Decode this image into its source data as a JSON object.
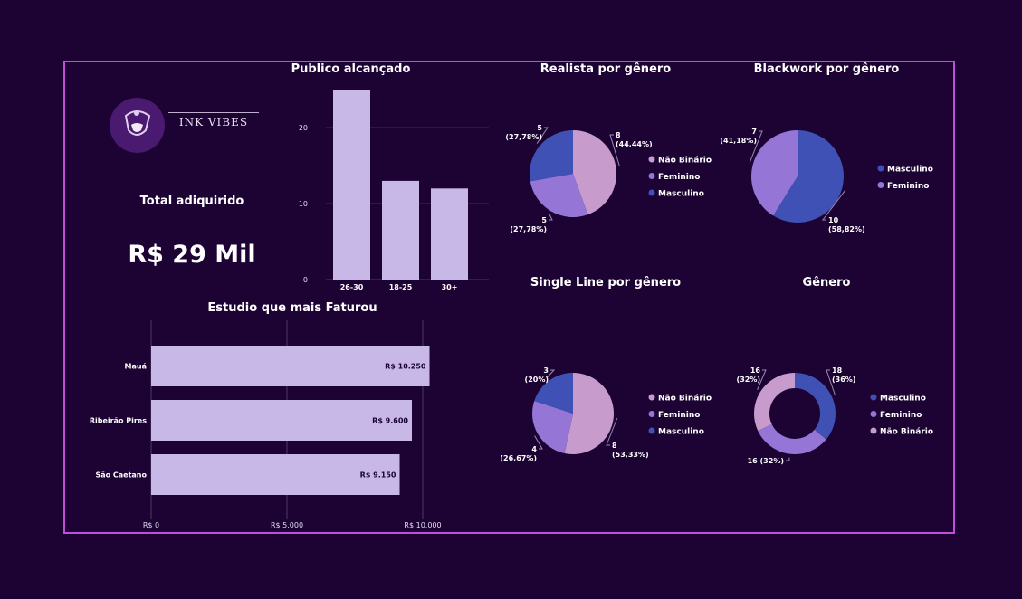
{
  "brand": {
    "logo_text": "INK VIBES"
  },
  "kpi": {
    "label": "Total adiquirido",
    "value": "R$ 29 Mil"
  },
  "colors": {
    "background": "#1c0333",
    "border": "#c04fd8",
    "bar": "#c8b8e8",
    "masculino": "#3f51b5",
    "feminino": "#9575d6",
    "nao_binario": "#c79ccd"
  },
  "chart_data": [
    {
      "id": "publico",
      "type": "bar",
      "title": "Publico alcançado",
      "categories": [
        "26-30",
        "18-25",
        "30+"
      ],
      "values": [
        25,
        13,
        12
      ],
      "yticks": [
        "0",
        "10",
        "20"
      ],
      "ylim": [
        0,
        25.5
      ],
      "grid": true
    },
    {
      "id": "estudio",
      "type": "bar",
      "orientation": "horizontal",
      "title": "Estudio que mais Faturou",
      "categories": [
        "Mauá",
        "Ribeirão Pires",
        "São Caetano"
      ],
      "values": [
        10250,
        9600,
        9150
      ],
      "labels": [
        "R$ 10.250",
        "R$ 9.600",
        "R$ 9.150"
      ],
      "xticks": [
        "R$ 0",
        "R$ 5.000",
        "R$ 10.000"
      ],
      "xlim": [
        0,
        10000
      ],
      "grid": true
    },
    {
      "id": "realista",
      "type": "pie",
      "title": "Realista por gênero",
      "slices": [
        {
          "name": "Não Binário",
          "value": 8,
          "label": "8",
          "pct": "(44,44%)"
        },
        {
          "name": "Feminino",
          "value": 5,
          "label": "5",
          "pct": "(27,78%)"
        },
        {
          "name": "Masculino",
          "value": 5,
          "label": "5",
          "pct": "(27,78%)"
        }
      ],
      "legend": [
        "Não Binário",
        "Feminino",
        "Masculino"
      ]
    },
    {
      "id": "blackwork",
      "type": "pie",
      "title": "Blackwork por gênero",
      "slices": [
        {
          "name": "Masculino",
          "value": 10,
          "label": "10",
          "pct": "(58,82%)"
        },
        {
          "name": "Feminino",
          "value": 7,
          "label": "7",
          "pct": "(41,18%)"
        }
      ],
      "legend": [
        "Masculino",
        "Feminino"
      ]
    },
    {
      "id": "singleline",
      "type": "pie",
      "title": "Single Line por gênero",
      "slices": [
        {
          "name": "Não Binário",
          "value": 8,
          "label": "8",
          "pct": "(53,33%)"
        },
        {
          "name": "Feminino",
          "value": 4,
          "label": "4",
          "pct": "(26,67%)"
        },
        {
          "name": "Masculino",
          "value": 3,
          "label": "3",
          "pct": "(20%)"
        }
      ],
      "legend": [
        "Não Binário",
        "Feminino",
        "Masculino"
      ]
    },
    {
      "id": "genero",
      "type": "donut",
      "title": "Gênero",
      "slices": [
        {
          "name": "Masculino",
          "value": 18,
          "label": "18",
          "pct": "(36%)"
        },
        {
          "name": "Feminino",
          "value": 16,
          "label": "16 (32%)",
          "pct": ""
        },
        {
          "name": "Não Binário",
          "value": 16,
          "label": "16",
          "pct": "(32%)"
        }
      ],
      "legend": [
        "Masculino",
        "Feminino",
        "Não Binário"
      ]
    }
  ]
}
